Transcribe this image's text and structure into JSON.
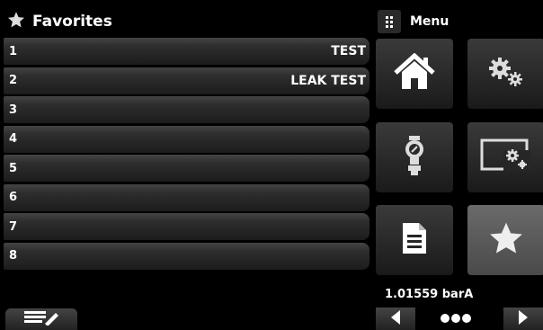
{
  "header": {
    "title": "Favorites",
    "star_icon": "star-icon"
  },
  "menu": {
    "label": "Menu",
    "icon": "grid-icon"
  },
  "favorites": [
    {
      "number": "1",
      "label": "TEST"
    },
    {
      "number": "2",
      "label": "LEAK TEST"
    },
    {
      "number": "3",
      "label": ""
    },
    {
      "number": "4",
      "label": ""
    },
    {
      "number": "5",
      "label": ""
    },
    {
      "number": "6",
      "label": ""
    },
    {
      "number": "7",
      "label": ""
    },
    {
      "number": "8",
      "label": ""
    }
  ],
  "tiles": [
    {
      "icon": "home-icon"
    },
    {
      "icon": "gears-icon"
    },
    {
      "icon": "sensor-icon"
    },
    {
      "icon": "display-settings-icon"
    },
    {
      "icon": "document-icon"
    },
    {
      "icon": "star-icon",
      "selected": true
    }
  ],
  "status": {
    "pressure": "1.01559 barA"
  },
  "bottom_bar": {
    "edit_icon": "edit-list-icon",
    "prev_icon": "arrow-left-icon",
    "next_icon": "arrow-right-icon",
    "page_indicator": "page-dots"
  },
  "colors": {
    "background": "#000000",
    "row": "#2e2e2e",
    "tile": "#262626",
    "tile_selected": "#5a5a5a",
    "text": "#ffffff"
  }
}
